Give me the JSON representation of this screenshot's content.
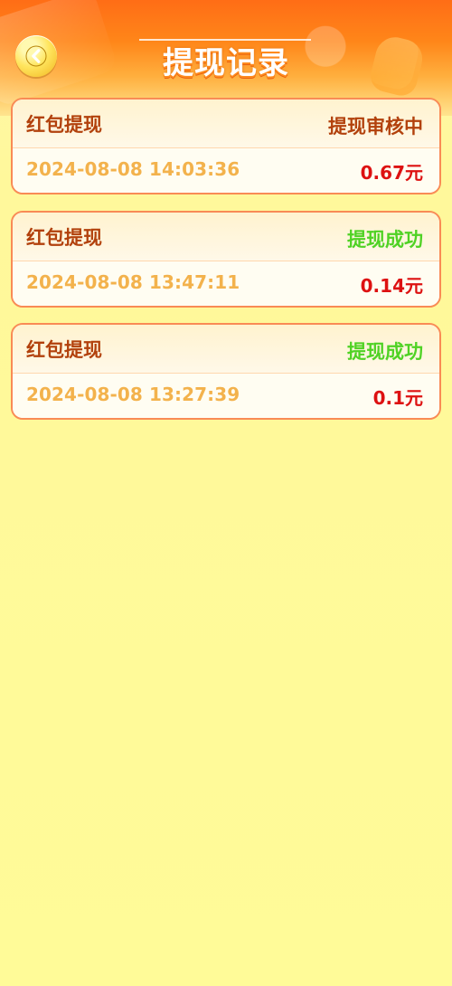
{
  "header": {
    "title": "提现记录",
    "back_icon": "chevron-left-icon"
  },
  "colors": {
    "header_orange": "#ff7a18",
    "page_yellow": "#fffb98",
    "card_border": "#f98b55",
    "label_brown": "#b2410c",
    "time_orange": "#f3b24c",
    "amount_red": "#dd1111",
    "success_green": "#4fd224"
  },
  "records": [
    {
      "type": "红包提现",
      "status": "提现审核中",
      "time": "2024-08-08 14:03:36",
      "amount": "0.67元"
    },
    {
      "type": "红包提现",
      "status": "提现成功",
      "time": "2024-08-08 13:47:11",
      "amount": "0.14元"
    },
    {
      "type": "红包提现",
      "status": "提现成功",
      "time": "2024-08-08 13:27:39",
      "amount": "0.1元"
    }
  ]
}
